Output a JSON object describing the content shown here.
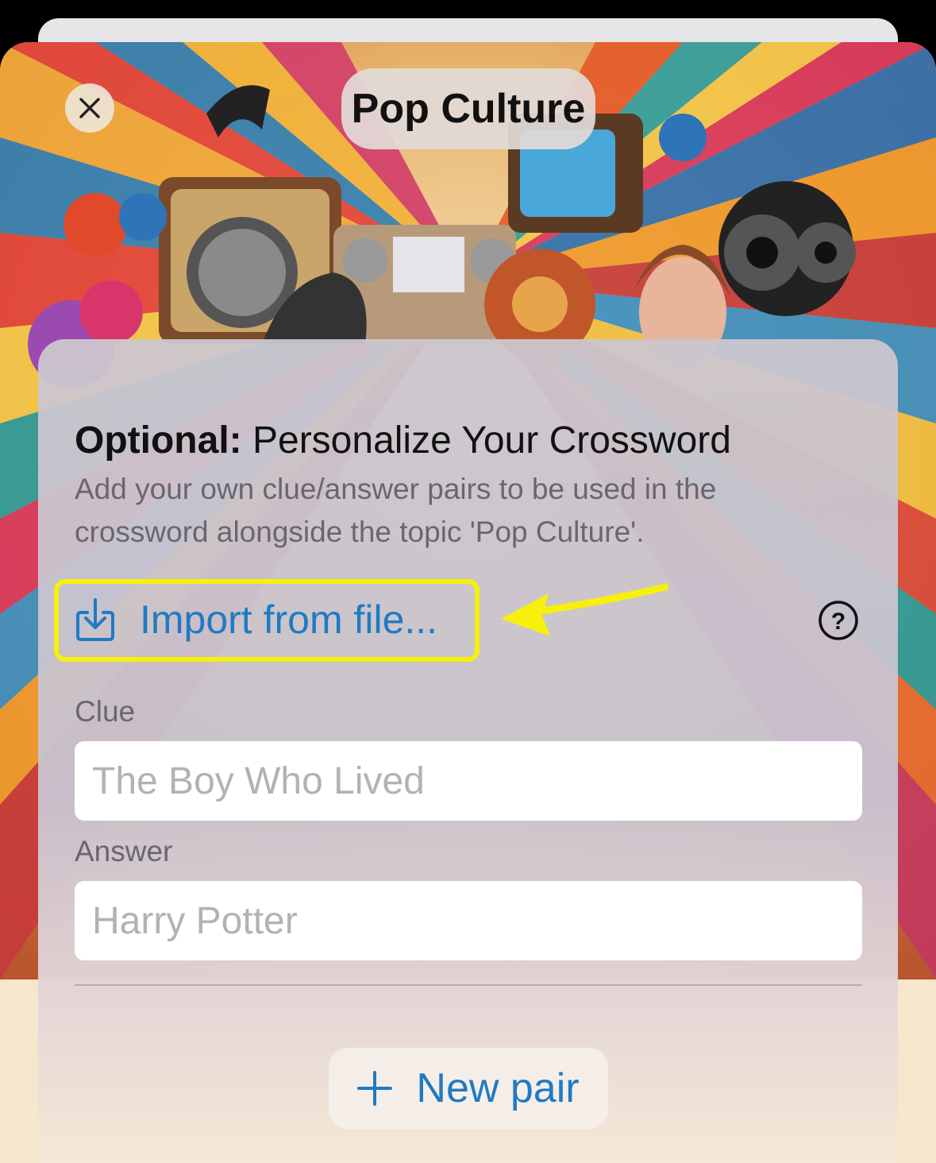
{
  "header": {
    "title": "Pop Culture",
    "close_icon": "close-icon"
  },
  "card": {
    "heading_bold": "Optional:",
    "heading_rest": " Personalize Your Crossword",
    "subtitle": "Add your own clue/answer pairs to be used in the crossword alongside the topic 'Pop Culture'.",
    "import_label": "Import from file...",
    "import_icon": "import-file-icon",
    "help_icon": "question-circle-icon",
    "clue": {
      "label": "Clue",
      "placeholder": "The Boy Who Lived",
      "value": ""
    },
    "answer": {
      "label": "Answer",
      "placeholder": "Harry Potter",
      "value": ""
    },
    "new_pair_label": "New pair",
    "new_pair_icon": "plus-icon"
  },
  "colors": {
    "accent": "#1f7ac4",
    "highlight": "#f6f00c",
    "sheet_bottom": "#f5e6cc"
  }
}
